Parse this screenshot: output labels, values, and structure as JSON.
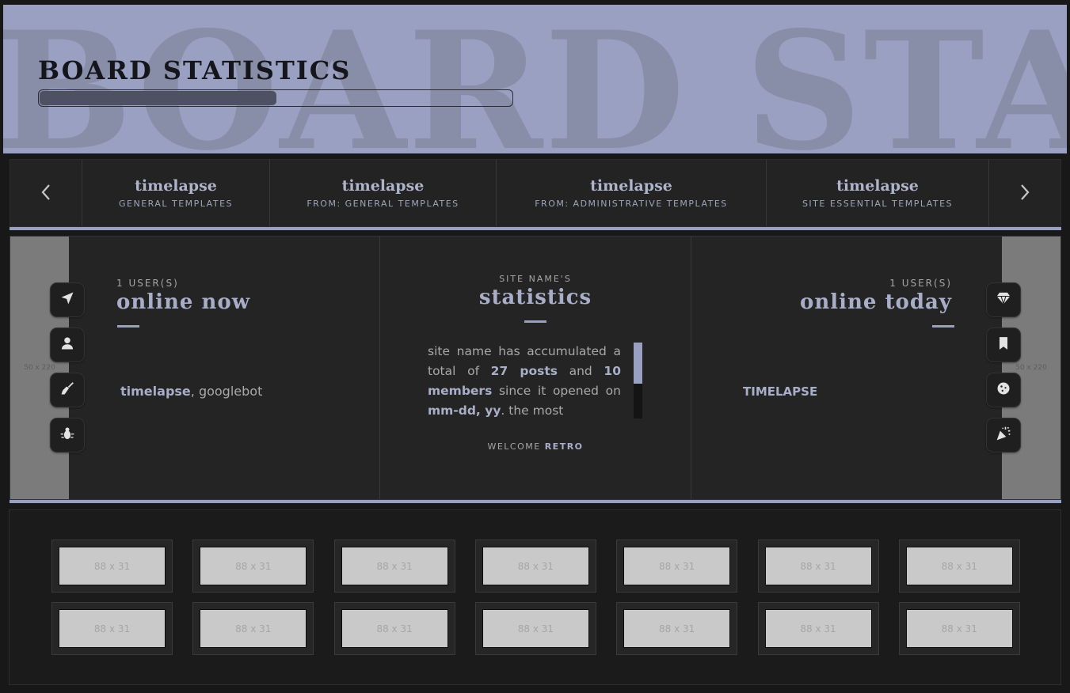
{
  "header": {
    "bg_text": "BOARD STAT",
    "title": "BOARD STATISTICS",
    "progress_fraction": 0.5
  },
  "topics": {
    "prev_icon": "chevron-left-icon",
    "next_icon": "chevron-right-icon",
    "items": [
      {
        "title": "timelapse",
        "subtitle": "GENERAL TEMPLATES"
      },
      {
        "title": "timelapse",
        "subtitle": "FROM: GENERAL TEMPLATES"
      },
      {
        "title": "timelapse",
        "subtitle": "FROM: ADMINISTRATIVE TEMPLATES"
      },
      {
        "title": "timelapse",
        "subtitle": "SITE ESSENTIAL TEMPLATES"
      }
    ]
  },
  "side_images": {
    "left": "50 x 220",
    "right": "50 x 220"
  },
  "left_icons": [
    "navigation-arrow-icon",
    "user-icon",
    "broom-icon",
    "bug-icon"
  ],
  "right_icons": [
    "diamond-icon",
    "bookmark-icon",
    "cookie-icon",
    "party-popper-icon"
  ],
  "online_now": {
    "count_label": "1 USER(S)",
    "title": "online now",
    "user": "timelapse",
    "bots": ", googlebot"
  },
  "statistics": {
    "label": "SITE NAME'S",
    "title": "statistics",
    "text_1": "site name has accumulated a total of ",
    "posts": "27 posts",
    "text_2": " and ",
    "members": "10 members",
    "text_3": " since it opened on ",
    "date": "mm-dd, yy",
    "text_4": ". the most",
    "welcome": "WELCOME ",
    "welcome_user": "RETRO"
  },
  "online_today": {
    "count_label": "1 USER(S)",
    "title": "online today",
    "user": "TIMELAPSE"
  },
  "affiliates": {
    "label": "88 x 31",
    "rows": 2,
    "cols": 7
  },
  "colors": {
    "accent": "#9aa0c1",
    "background": "#181818",
    "panel": "#242424"
  }
}
